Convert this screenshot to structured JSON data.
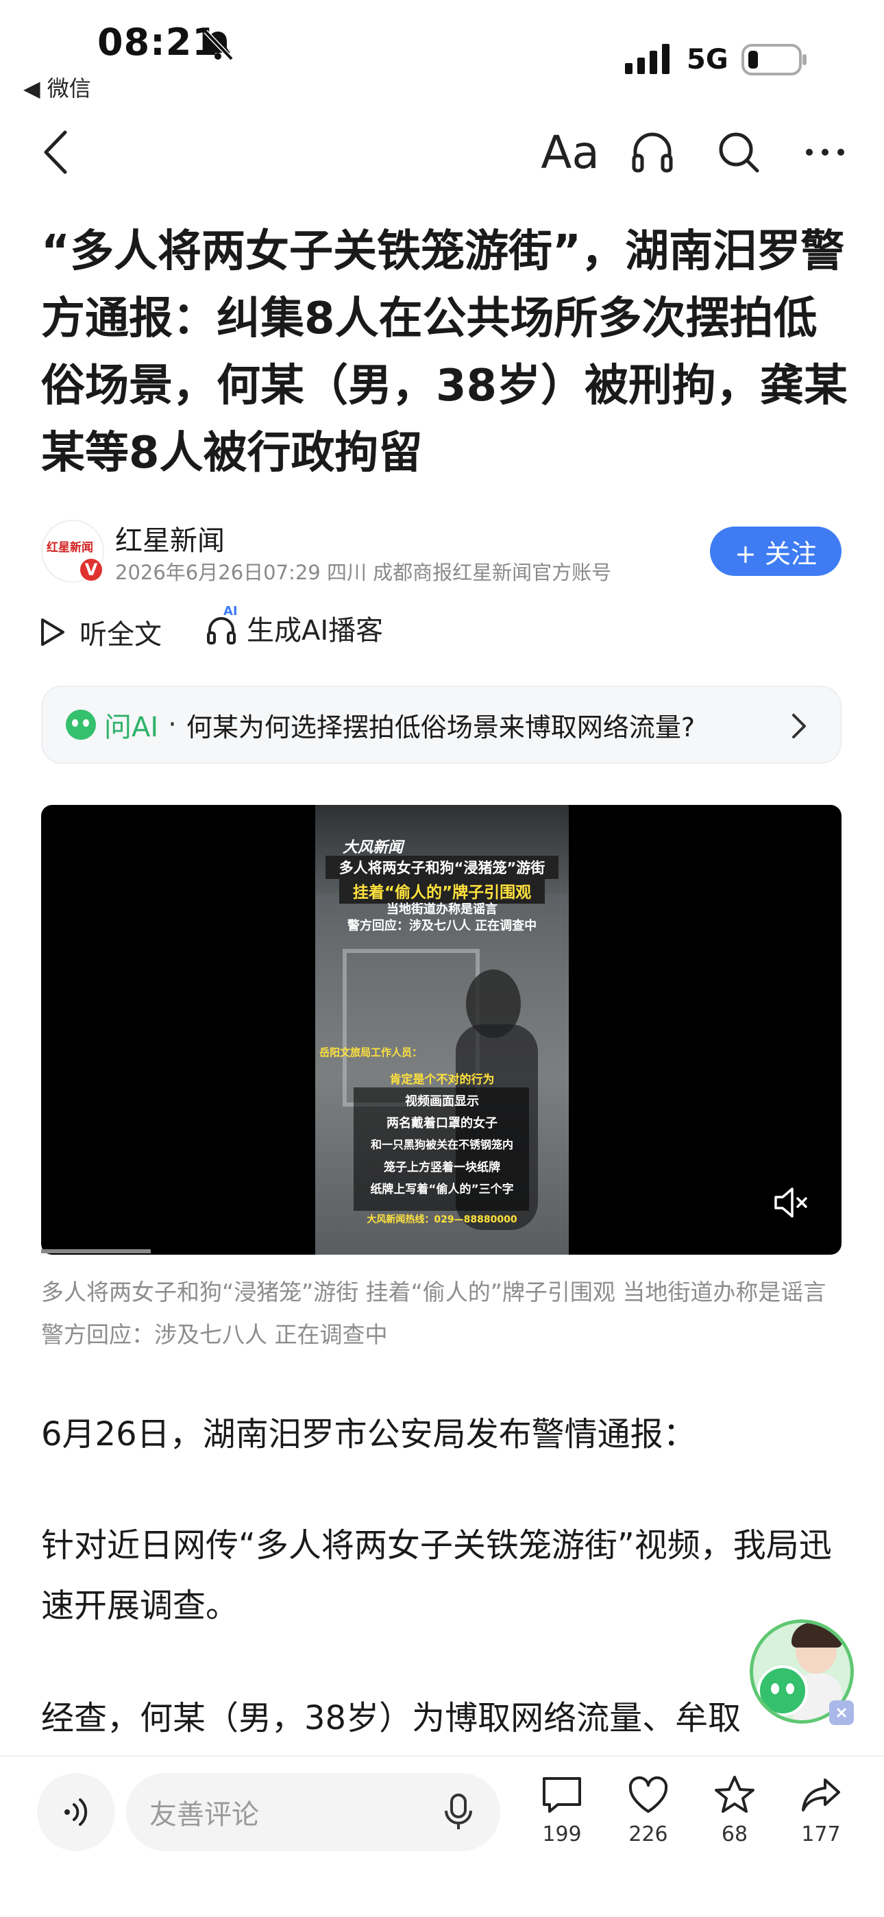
{
  "status_bar": {
    "time": "08:21",
    "back_app": "◀ 微信",
    "network": "5G"
  },
  "nav": {
    "back_icon": "chevron-left-icon",
    "font_icon": "font-size-icon",
    "font_label": "Aa",
    "listen_icon": "headphones-icon",
    "search_icon": "search-icon",
    "more_icon": "more-icon"
  },
  "article": {
    "headline": "“多人将两女子关铁笼游街”，湖南汨罗警方通报：纠集8人在公共场所多次摆拍低俗场景，何某（男，38岁）被刑拘，龚某某等8人被行政拘留",
    "author": {
      "name": "红星新闻",
      "meta": "2026年6月26日07:29 四川 成都商报红星新闻官方账号",
      "avatar_text": "红星新闻",
      "badge": "V",
      "follow_label": "+ 关注"
    },
    "listen_label": "听全文",
    "podcast_label": "生成AI播客",
    "podcast_badge": "AI",
    "ask_ai": {
      "label": "问AI",
      "dot": "·",
      "question": "何某为何选择摆拍低俗场景来博取网络流量?"
    },
    "video": {
      "logo": "大风新闻",
      "title_line1": "多人将两女子和狗“浸猪笼”游街",
      "title_line2": "挂着“偷人的”牌子引围观",
      "subtitle_line1": "当地街道办称是谣言",
      "subtitle_line2": "警方回应：涉及七八人 正在调查中",
      "speaker_label": "岳阳文旅局工作人员：",
      "speaker_quote": "肯定是个不对的行为",
      "desc": [
        "视频画面显示",
        "两名戴着口罩的女子",
        "和一只黑狗被关在不锈钢笼内",
        "笼子上方竖着一块纸牌",
        "纸牌上写着“偷人的”三个字"
      ],
      "hotline": "大风新闻热线：029—88880000",
      "mute_icon": "mute-icon"
    },
    "caption": "多人将两女子和狗“浸猪笼”游街 挂着“偷人的”牌子引围观 当地街道办称是谣言 警方回应：涉及七八人 正在调查中",
    "paragraphs": [
      "6月26日，湖南汨罗市公安局发布警情通报：",
      "针对近日网传“多人将两女子关铁笼游街”视频，我局迅速开展调查。",
      "经查，何某（男，38岁）为博取网络流量、牟取"
    ]
  },
  "bottom_bar": {
    "comment_placeholder": "友善评论",
    "comments": "199",
    "likes": "226",
    "favorites": "68",
    "shares": "177"
  },
  "colors": {
    "accent": "#3f7cf3",
    "ai_green": "#2fb26b",
    "caption_gray": "#8d8d8d"
  }
}
